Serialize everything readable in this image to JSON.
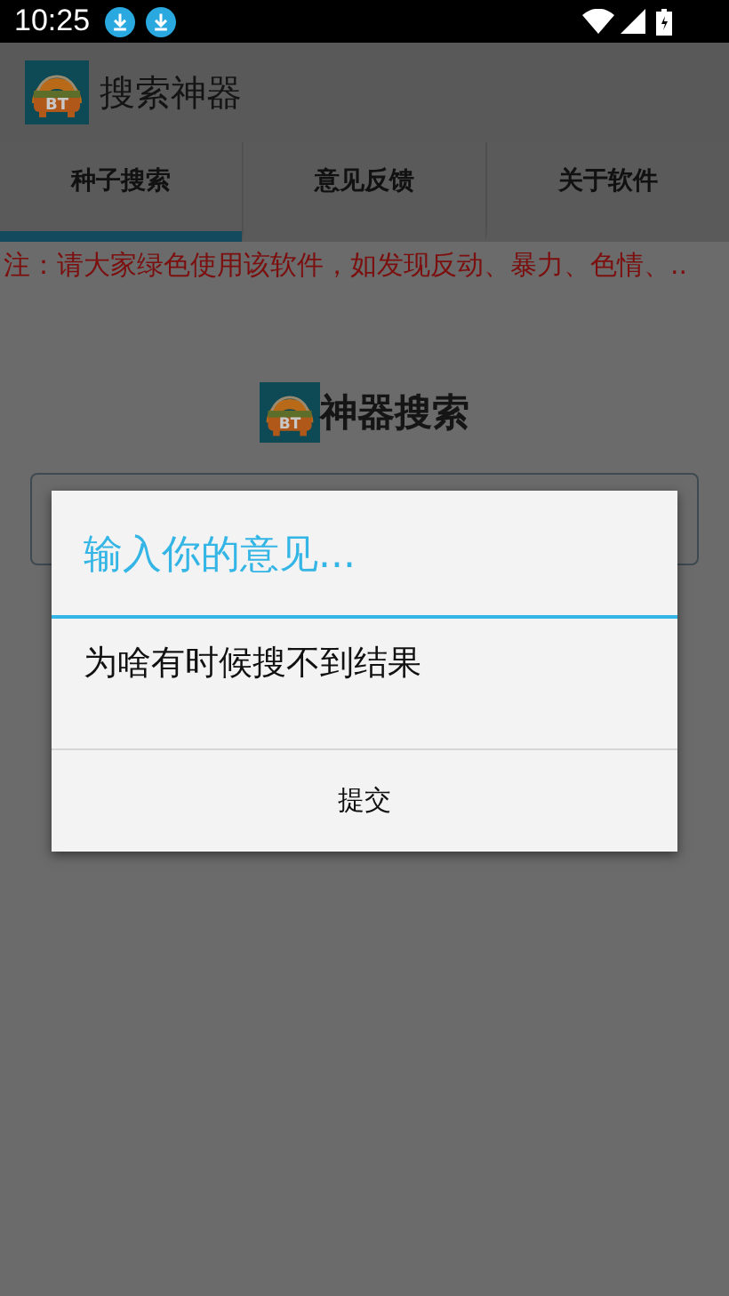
{
  "status_bar": {
    "time": "10:25"
  },
  "action_bar": {
    "logo_text": "BT",
    "title": "搜索神器"
  },
  "tabs": [
    {
      "label": "种子搜索",
      "selected": true
    },
    {
      "label": "意见反馈",
      "selected": false
    },
    {
      "label": "关于软件",
      "selected": false
    }
  ],
  "notice": "注：请大家绿色使用该软件，如发现反动、暴力、色情、..",
  "search_logo_text": "BT",
  "search_heading": "神器搜索",
  "dialog": {
    "title": "输入你的意见...",
    "message": "为啥有时候搜不到结果",
    "buttons": [
      "提交"
    ]
  }
}
